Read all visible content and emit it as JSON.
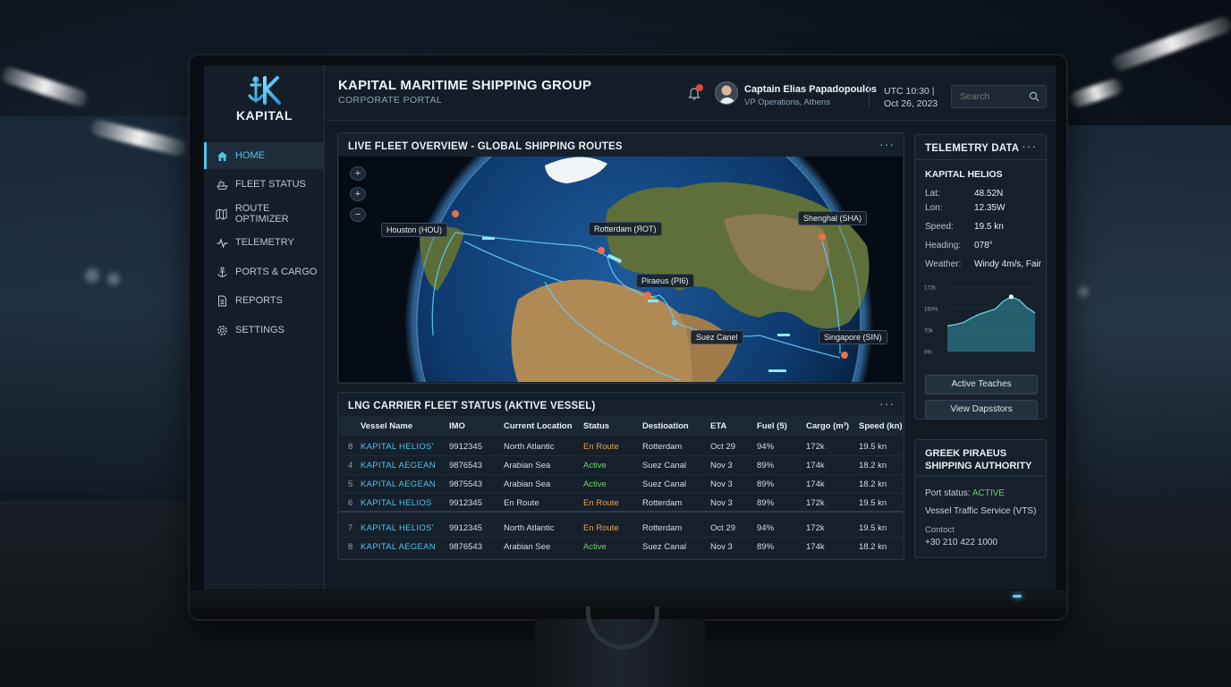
{
  "brand": {
    "logo_text": "KAPITAL"
  },
  "sidebar": {
    "items": [
      {
        "label": "HOME",
        "icon": "home-icon"
      },
      {
        "label": "FLEET STATUS",
        "icon": "ship-icon"
      },
      {
        "label": "ROUTE OPTIMIZER",
        "icon": "map-icon"
      },
      {
        "label": "TELEMETRY",
        "icon": "pulse-icon"
      },
      {
        "label": "PORTS & CARGO",
        "icon": "anchor-icon"
      },
      {
        "label": "REPORTS",
        "icon": "document-icon"
      },
      {
        "label": "SETTINGS",
        "icon": "gear-icon"
      }
    ],
    "active_index": 0
  },
  "header": {
    "company": "KAPITAL MARITIME SHIPPING GROUP",
    "subtitle": "CORPORATE PORTAL",
    "user_name": "Captain Elias Papadopoulos",
    "user_role": "VP Operations, Athens",
    "utc_time": "UTC 10:30  |",
    "date": "Oct 26, 2023",
    "search_placeholder": "Search"
  },
  "map_panel": {
    "title": "LIVE FLEET OVERVIEW - GLOBAL SHIPPING ROUTES",
    "menu": "···",
    "zoom_buttons": [
      "+",
      "+",
      "−"
    ],
    "labels": {
      "houston": "Houston (HOU)",
      "rotterdam": "Rotterdam (ЯOT)",
      "shenghal": "Shenghal (SHA)",
      "piraeus": "Piraeus (PI6)",
      "suez": "Suez Canel",
      "singapore": "Singapore (SIN)"
    }
  },
  "fleet_table": {
    "title": "LNG CARRIER FLEET STATUS (AKTIVE VESSEL)",
    "menu": "···",
    "columns": [
      "Vessel Name",
      "IMO",
      "Current Location",
      "Status",
      "Destioation",
      "ETA",
      "Fuel (5)",
      "Cargo (m³)",
      "Speed (kn)"
    ],
    "rows": [
      {
        "idx": "8",
        "vessel": "KAPITAL HELIOS'",
        "imo": "9912345",
        "location": "North Atlantic",
        "status": "En Route",
        "dest": "Rotterdam",
        "eta": "Oct 29",
        "fuel": "94%",
        "cargo": "172k",
        "speed": "19.5 kn"
      },
      {
        "idx": "4",
        "vessel": "KAPITAL AEGEAN",
        "imo": "9876543",
        "location": "Arabian Sea",
        "status": "Active",
        "dest": "Suez Canal",
        "eta": "Nov 3",
        "fuel": "89%",
        "cargo": "174k",
        "speed": "18.2 kn"
      },
      {
        "idx": "5",
        "vessel": "KAPITAL AEGEAN",
        "imo": "9875543",
        "location": "Arabian Sea",
        "status": "Active",
        "dest": "Suez Canal",
        "eta": "Nov 3",
        "fuel": "89%",
        "cargo": "174k",
        "speed": "18.2 kn"
      },
      {
        "idx": "6",
        "vessel": "KAPITAL HELIOS",
        "imo": "9912345",
        "location": "En Route",
        "status": "En Route",
        "dest": "Rotterdam",
        "eta": "Nov 3",
        "fuel": "89%",
        "cargo": "172k",
        "speed": "19.5 kn"
      },
      {
        "idx": "7",
        "vessel": "KAPITAL HELIOS'",
        "imo": "9912345",
        "location": "North Atlantic",
        "status": "En Route",
        "dest": "Rotterdam",
        "eta": "Oct 29",
        "fuel": "94%",
        "cargo": "172k",
        "speed": "19.5 kn"
      },
      {
        "idx": "8",
        "vessel": "KAPITAL AEGEAN",
        "imo": "9876543",
        "location": "Arabian See",
        "status": "Active",
        "dest": "Suez Canal",
        "eta": "Nov 3",
        "fuel": "89%",
        "cargo": "174k",
        "speed": "18.2 kn"
      }
    ]
  },
  "telemetry": {
    "title": "TELEMETRY DATA",
    "menu": "···",
    "vessel": "KAPITAL HELIOS",
    "lat_label": "Lat:",
    "lat": "48.52N",
    "lon_label": "Lon:",
    "lon": "12.35W",
    "speed_label": "Speed:",
    "speed": "19.5 kn",
    "heading_label": "Heading:",
    "heading": "078°",
    "weather_label": "Weather:",
    "weather": "Windy 4m/s, Fair",
    "chart_ticks": [
      "172k",
      "160%",
      "70k",
      "0%"
    ],
    "chart_values": [
      40,
      42,
      45,
      52,
      58,
      62,
      66,
      78,
      85,
      80,
      68,
      60
    ],
    "btn_active": "Active Teaches",
    "btn_view": "View Dapsstors"
  },
  "authority": {
    "title_line1": "GREEK PIRAEUS",
    "title_line2": "SHIPPING AUTHORITY",
    "port_status_label": "Port status:",
    "port_status": "ACTIVE",
    "vts": "Vessel Traffic Service (VTS)",
    "contact_label": "Contoct",
    "phone": "+30 210 422 1000"
  },
  "colors": {
    "accent": "#4fc3ea",
    "enroute": "#f0a045",
    "active": "#6ed06a"
  }
}
